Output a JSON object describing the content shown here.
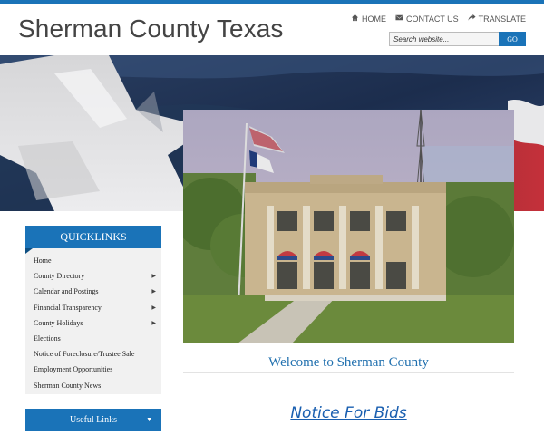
{
  "site": {
    "title": "Sherman County Texas"
  },
  "util_nav": [
    {
      "icon": "home-icon",
      "label": "HOME"
    },
    {
      "icon": "envelope-icon",
      "label": "CONTACT US"
    },
    {
      "icon": "share-icon",
      "label": "TRANSLATE"
    }
  ],
  "search": {
    "placeholder": "Search website...",
    "button": "GO"
  },
  "quicklinks": {
    "title": "QUICKLINKS",
    "items": [
      {
        "label": "Home",
        "has_submenu": false
      },
      {
        "label": "County Directory",
        "has_submenu": true
      },
      {
        "label": "Calendar and Postings",
        "has_submenu": true
      },
      {
        "label": "Financial Transparency",
        "has_submenu": true
      },
      {
        "label": "County Holidays",
        "has_submenu": true
      },
      {
        "label": "Elections",
        "has_submenu": false
      },
      {
        "label": "Notice of Foreclosure/Trustee Sale",
        "has_submenu": false
      },
      {
        "label": "Employment Opportunities",
        "has_submenu": false
      },
      {
        "label": "Sherman County News",
        "has_submenu": false
      }
    ]
  },
  "useful_links": {
    "label": "Useful Links"
  },
  "main": {
    "welcome": "Welcome to Sherman County",
    "notice_link": "Notice For Bids"
  },
  "colors": {
    "accent": "#1a73b8",
    "heading": "#1f6fae"
  }
}
